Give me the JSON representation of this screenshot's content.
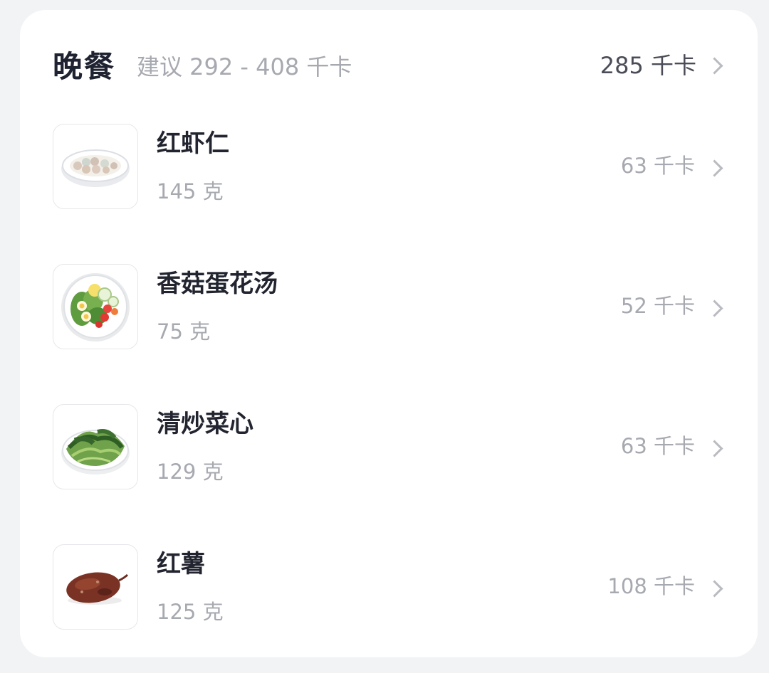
{
  "meal": {
    "title": "晚餐",
    "suggestion": "建议 292 - 408 千卡",
    "total_kcal": "285 千卡"
  },
  "items": [
    {
      "name": "红虾仁",
      "weight": "145 克",
      "kcal": "63 千卡",
      "icon": "shrimp-plate-icon"
    },
    {
      "name": "香菇蛋花汤",
      "weight": "75 克",
      "kcal": "52 千卡",
      "icon": "salad-plate-icon"
    },
    {
      "name": "清炒菜心",
      "weight": "129 克",
      "kcal": "63 千卡",
      "icon": "greens-plate-icon"
    },
    {
      "name": "红薯",
      "weight": "125 克",
      "kcal": "108 千卡",
      "icon": "sweet-potato-icon"
    }
  ]
}
